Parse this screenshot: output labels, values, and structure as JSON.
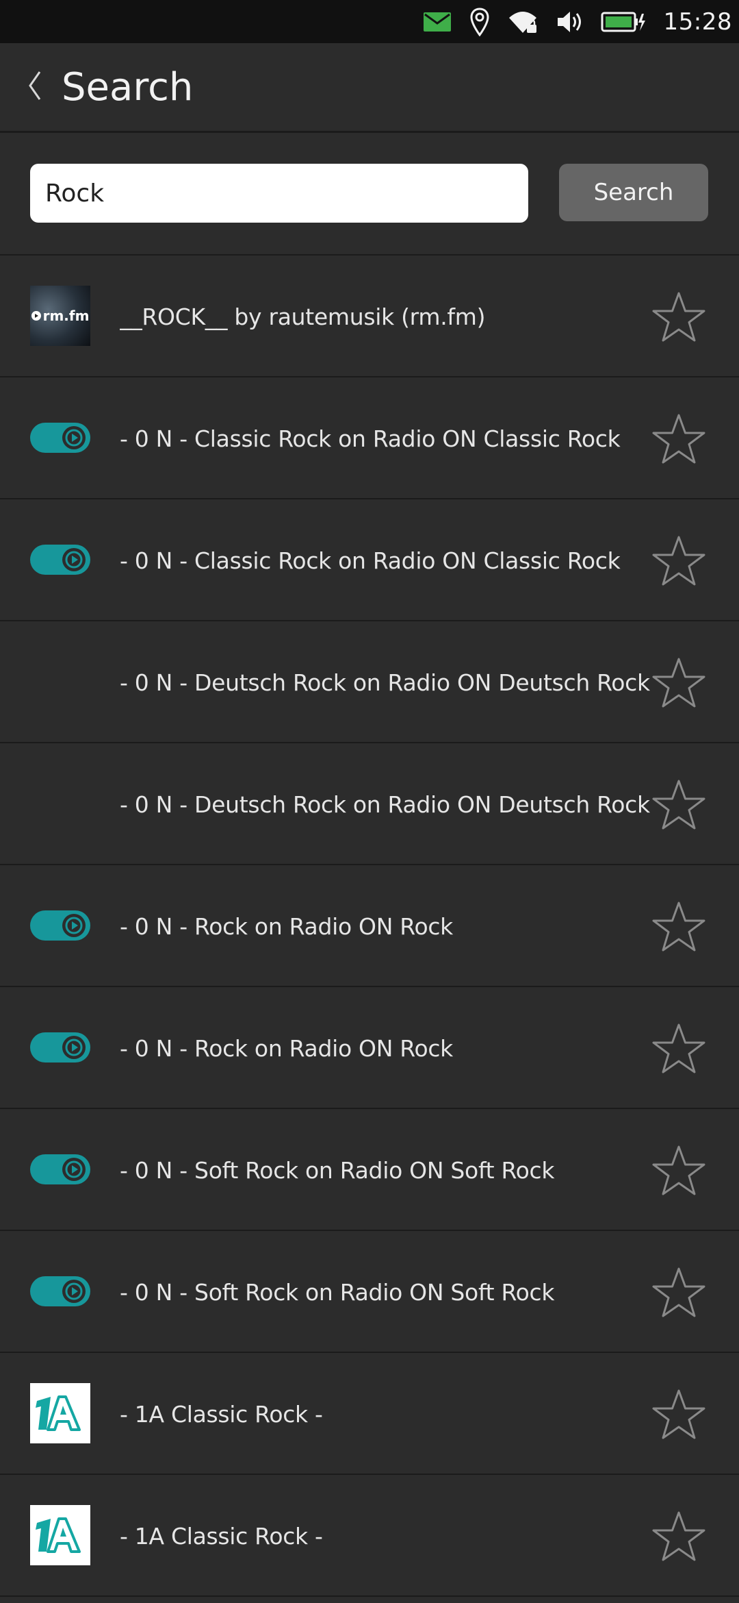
{
  "status_bar": {
    "time": "15:28",
    "icons": [
      "mail-icon",
      "location-icon",
      "wifi-icon",
      "volume-icon",
      "battery-charging-icon"
    ],
    "mail_color": "#3fae49",
    "battery_color": "#3fae49"
  },
  "header": {
    "back_icon": "chevron-left-icon",
    "title": "Search"
  },
  "search": {
    "query": "Rock",
    "button_label": "Search"
  },
  "results": [
    {
      "name": "__ROCK__ by rautemusik (rm.fm)",
      "logo": "rmfm",
      "logo_text": "rm.fm"
    },
    {
      "name": "- 0 N - Classic Rock on Radio ON Classic Rock",
      "logo": "toggle"
    },
    {
      "name": "- 0 N - Classic Rock on Radio ON Classic Rock",
      "logo": "toggle"
    },
    {
      "name": "- 0 N - Deutsch Rock on Radio ON Deutsch Rock",
      "logo": "none"
    },
    {
      "name": "- 0 N - Deutsch Rock on Radio ON Deutsch Rock",
      "logo": "none"
    },
    {
      "name": "- 0 N - Rock on Radio ON Rock",
      "logo": "toggle"
    },
    {
      "name": "- 0 N - Rock on Radio ON Rock",
      "logo": "toggle"
    },
    {
      "name": "- 0 N - Soft Rock on Radio ON Soft Rock",
      "logo": "toggle"
    },
    {
      "name": "- 0 N - Soft Rock on Radio ON Soft Rock",
      "logo": "toggle"
    },
    {
      "name": "- 1A Classic Rock -",
      "logo": "1a"
    },
    {
      "name": "- 1A Classic Rock -",
      "logo": "1a"
    }
  ],
  "colors": {
    "background": "#2c2c2c",
    "accent_teal": "#17979b",
    "divider": "#1b1b1b",
    "star": "#8a8a8a"
  }
}
